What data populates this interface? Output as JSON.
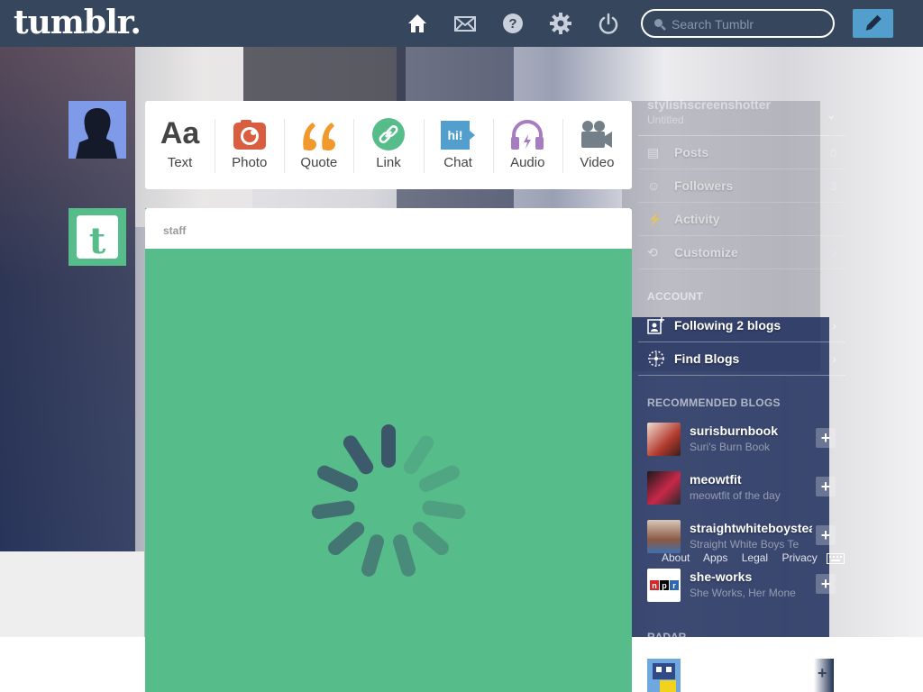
{
  "header": {
    "logo": "tumblr.",
    "search_placeholder": "Search Tumblr",
    "nav_icons": [
      "home-icon",
      "mail-icon",
      "help-icon",
      "gear-icon",
      "power-icon"
    ]
  },
  "post_types": [
    {
      "label": "Text",
      "icon": "text-icon",
      "color": "#444444"
    },
    {
      "label": "Photo",
      "icon": "camera-icon",
      "color": "#d95e40"
    },
    {
      "label": "Quote",
      "icon": "quote-icon",
      "color": "#f2992e"
    },
    {
      "label": "Link",
      "icon": "link-icon",
      "color": "#56bc8a"
    },
    {
      "label": "Chat",
      "icon": "chat-icon",
      "color": "#529ecc"
    },
    {
      "label": "Audio",
      "icon": "headphones-icon",
      "color": "#a77dc2"
    },
    {
      "label": "Video",
      "icon": "video-camera-icon",
      "color": "#748089"
    }
  ],
  "post": {
    "author": "staff",
    "background_color": "#56bc8a"
  },
  "sidebar": {
    "blog_name": "stylishscreenshotter",
    "blog_title": "Untitled",
    "rows": [
      {
        "label": "Posts",
        "count": "0"
      },
      {
        "label": "Followers",
        "count": "3"
      },
      {
        "label": "Activity",
        "count": ""
      },
      {
        "label": "Customize",
        "count": ""
      }
    ],
    "account_heading": "ACCOUNT",
    "account_rows": [
      {
        "label": "Following 2 blogs"
      },
      {
        "label": "Find Blogs"
      }
    ],
    "recommended_heading": "RECOMMENDED BLOGS",
    "recommended": [
      {
        "name": "surisburnbook",
        "title": "Suri's Burn Book"
      },
      {
        "name": "meowtfit",
        "title": "meowtfit of the day"
      },
      {
        "name": "straightwhiteboysteaxting",
        "title": "Straight White Boys Te"
      },
      {
        "name": "she-works",
        "title": "She Works, Her Mone"
      }
    ],
    "footer_links": [
      "About",
      "Apps",
      "Legal",
      "Privacy"
    ],
    "radar_heading": "RADAR"
  },
  "colors": {
    "header_bg": "#36465d",
    "compose_bg": "#529ecc",
    "staff_green": "#56bc8a"
  }
}
